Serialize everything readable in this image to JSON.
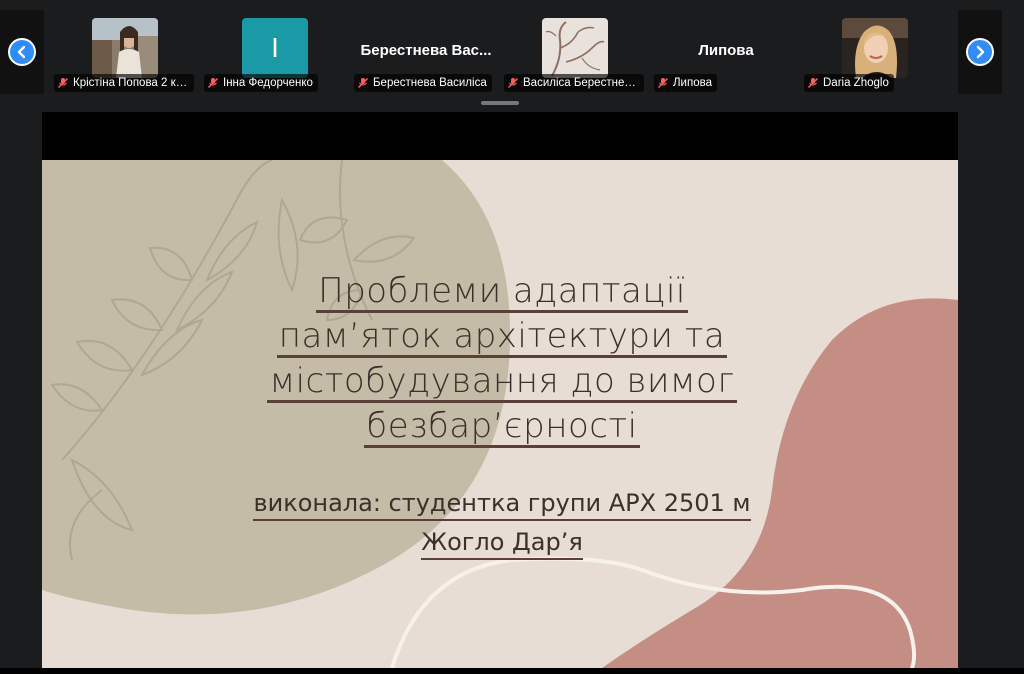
{
  "participants": [
    {
      "label": "Крістіна Попова 2 кур...",
      "display": "photo-woman-1"
    },
    {
      "label": "Інна Федорченко",
      "display": "initial",
      "initial": "I"
    },
    {
      "label": "Берестнева Василіса",
      "display": "name",
      "big_name": "Берестнева Вас..."
    },
    {
      "label": "Василіса Берестнева А...",
      "display": "photo-branches"
    },
    {
      "label": "Липова",
      "display": "name",
      "big_name": "Липова"
    },
    {
      "label": "Daria Zhoglo",
      "display": "photo-woman-2"
    }
  ],
  "slide": {
    "title_lines": [
      "Проблеми адаптації",
      "пам’яток архітектури та",
      "містобудування до вимог",
      "безбар’єрності"
    ],
    "subtitle_lines": [
      "виконала: студентка групи АРХ 2501 м",
      "Жогло Дар’я"
    ]
  },
  "icons": {
    "prev": "chevron-left-icon",
    "next": "chevron-right-icon",
    "muted": "mic-muted-icon"
  },
  "colors": {
    "accent": "#2d8cff",
    "slide_bg": "#e8ddd4",
    "olive_blob": "#c5bca8",
    "rose_blob": "#c48e84",
    "text": "#3d2f2a"
  }
}
